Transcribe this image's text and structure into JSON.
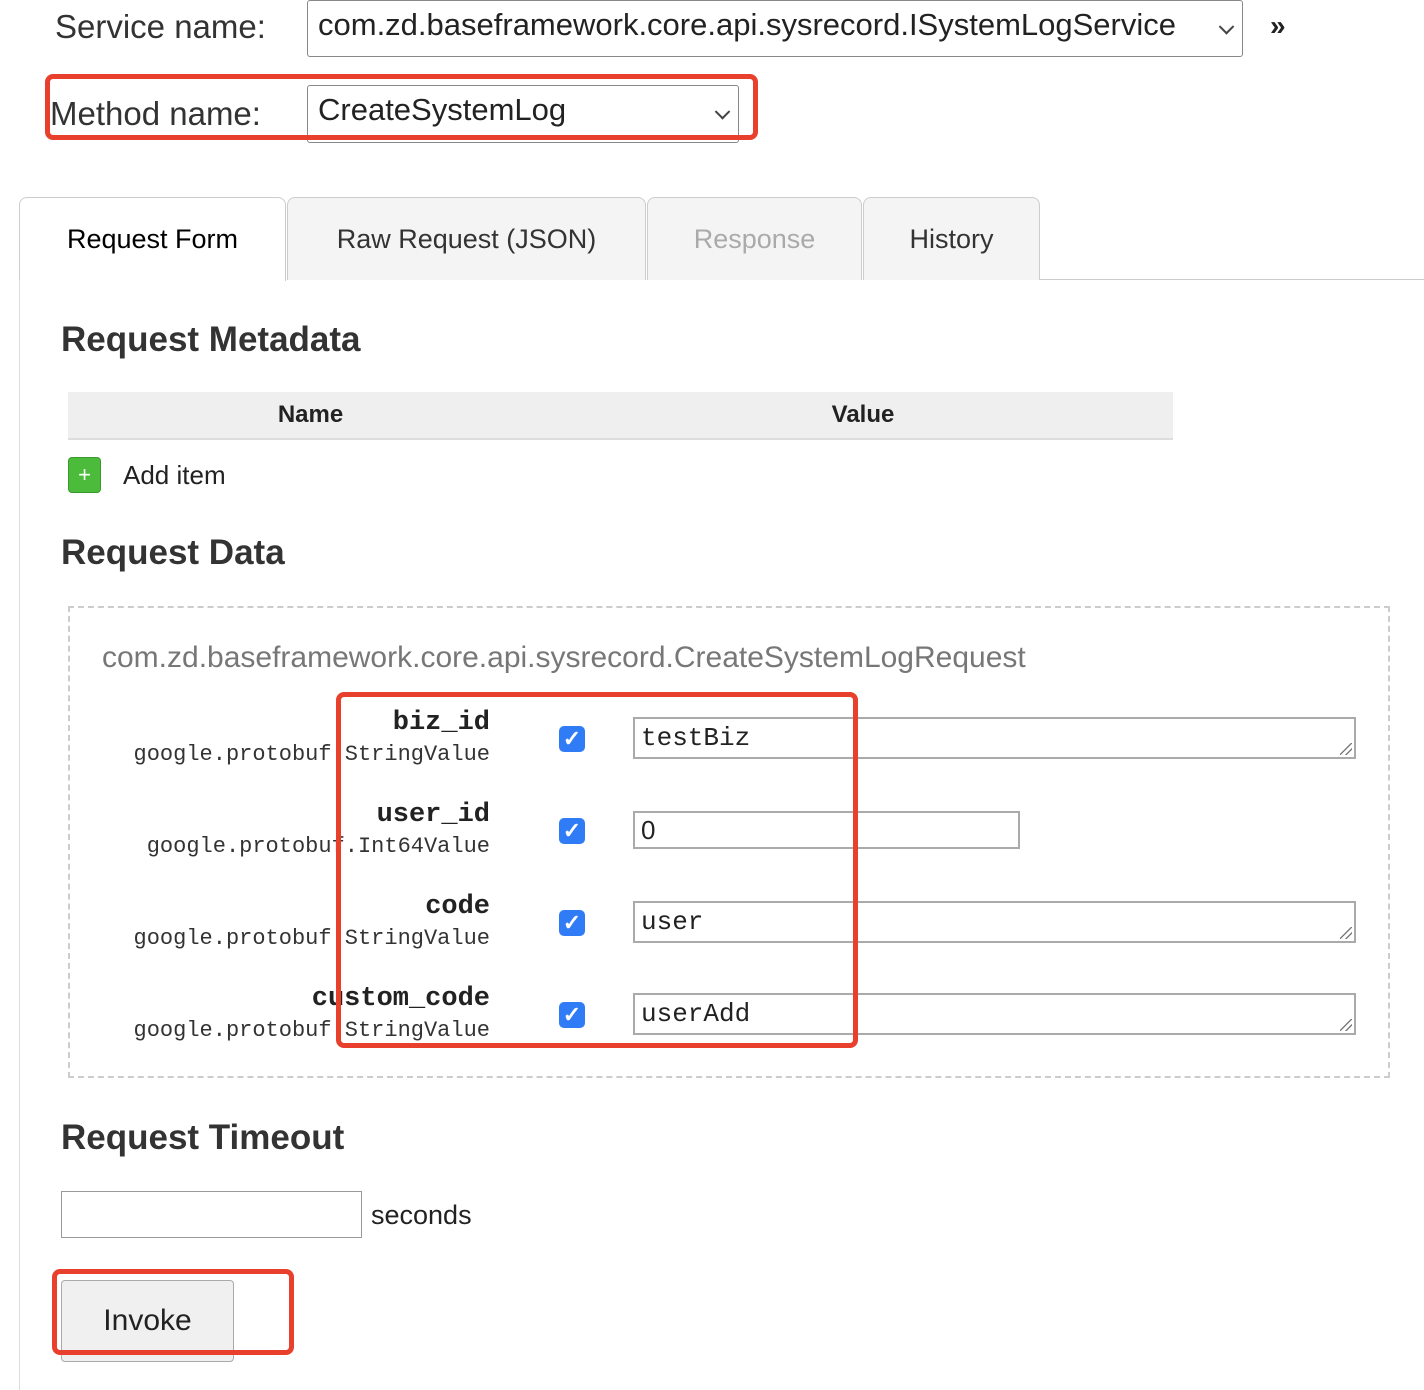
{
  "service": {
    "label": "Service name:",
    "value": "com.zd.baseframework.core.api.sysrecord.ISystemLogService",
    "expand_icon": "double-chevron-right"
  },
  "method": {
    "label": "Method name:",
    "value": "CreateSystemLog"
  },
  "tabs": [
    {
      "label": "Request Form",
      "state": "active"
    },
    {
      "label": "Raw Request (JSON)",
      "state": "normal"
    },
    {
      "label": "Response",
      "state": "disabled"
    },
    {
      "label": "History",
      "state": "normal"
    }
  ],
  "metadata": {
    "title": "Request Metadata",
    "columns": [
      "Name",
      "Value"
    ],
    "add_label": "Add item"
  },
  "request_data": {
    "title": "Request Data",
    "message_type": "com.zd.baseframework.core.api.sysrecord.CreateSystemLogRequest",
    "fields": [
      {
        "name": "biz_id",
        "type": "google.protobuf.StringValue",
        "checked": true,
        "value": "testBiz"
      },
      {
        "name": "user_id",
        "type": "google.protobuf.Int64Value",
        "checked": true,
        "value": "0"
      },
      {
        "name": "code",
        "type": "google.protobuf.StringValue",
        "checked": true,
        "value": "user"
      },
      {
        "name": "custom_code",
        "type": "google.protobuf.StringValue",
        "checked": true,
        "value": "userAdd"
      }
    ]
  },
  "timeout": {
    "title": "Request Timeout",
    "value": "",
    "unit": "seconds"
  },
  "invoke_label": "Invoke",
  "colors": {
    "annotation": "#e8402c",
    "checkbox": "#2f7cf6",
    "add_button": "#4cbb3c"
  }
}
